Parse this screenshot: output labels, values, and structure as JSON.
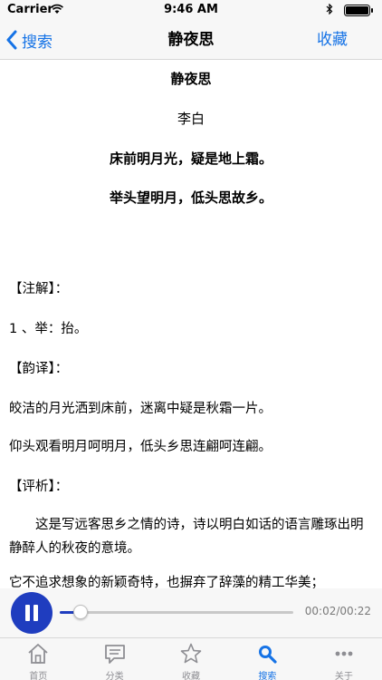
{
  "status_bar": {
    "carrier": "Carrier",
    "time": "9:46 AM"
  },
  "nav": {
    "back_label": "搜索",
    "title": "静夜思",
    "right_label": "收藏"
  },
  "poem": {
    "title": "静夜思",
    "author": "李白",
    "lines": [
      "床前明月光，疑是地上霜。",
      "举头望明月，低头思故乡。"
    ]
  },
  "notes": {
    "annotation_heading": "【注解】：",
    "annotation_items": [
      "1 、举：抬。"
    ],
    "translation_heading": "【韵译】：",
    "translation_lines": [
      "皎洁的月光洒到床前，迷离中疑是秋霜一片。",
      "仰头观看明月呵明月，低头乡思连翩呵连翩。"
    ],
    "analysis_heading": "【评析】：",
    "analysis_paragraph": "这是写远客思乡之情的诗，诗以明白如话的语言雕琢出明静醉人的秋夜的意境。",
    "analysis_partial": "它不追求想象的新颖奇特，也摒弃了辞藻的精工华美；"
  },
  "player": {
    "state": "playing",
    "current_time": "00:02",
    "total_time": "00:22",
    "time_text": "00:02/00:22",
    "progress": 0.09,
    "accent_color": "#1f3dbf"
  },
  "tabs": [
    {
      "label": "首页",
      "icon": "home-icon",
      "active": false
    },
    {
      "label": "分类",
      "icon": "category-icon",
      "active": false
    },
    {
      "label": "收藏",
      "icon": "star-icon",
      "active": false
    },
    {
      "label": "搜索",
      "icon": "search-icon",
      "active": true
    },
    {
      "label": "关于",
      "icon": "more-icon",
      "active": false
    }
  ],
  "colors": {
    "tint": "#1673e6",
    "inactive": "#8e8e93"
  }
}
